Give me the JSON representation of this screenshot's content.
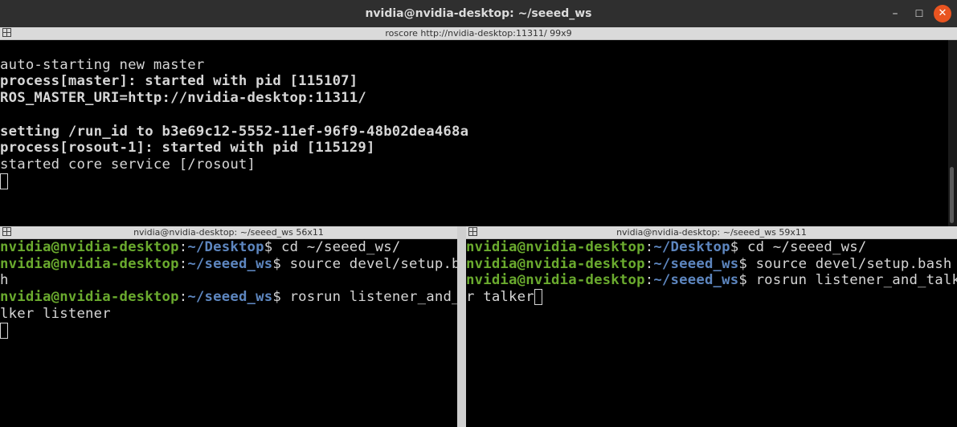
{
  "window": {
    "title": "nvidia@nvidia-desktop: ~/seeed_ws",
    "minimize_icon": "minimize-icon",
    "maximize_icon": "maximize-icon",
    "close_icon": "close-icon",
    "minimize_glyph": "–",
    "maximize_glyph": "☐",
    "close_glyph": "✕"
  },
  "top_pane": {
    "title": "roscore http://nvidia-desktop:11311/ 99x9",
    "lines": [
      {
        "text": "",
        "bold": false
      },
      {
        "text": "auto-starting new master",
        "bold": false
      },
      {
        "text": "process[master]: started with pid [115107]",
        "bold": true
      },
      {
        "text": "ROS_MASTER_URI=http://nvidia-desktop:11311/",
        "bold": true
      },
      {
        "text": "",
        "bold": false
      },
      {
        "text": "setting /run_id to b3e69c12-5552-11ef-96f9-48b02dea468a",
        "bold": true
      },
      {
        "text": "process[rosout-1]: started with pid [115129]",
        "bold": true
      },
      {
        "text": "started core service [/rosout]",
        "bold": false
      }
    ]
  },
  "left_pane": {
    "title": "nvidia@nvidia-desktop: ~/seeed_ws 56x11",
    "lines": [
      [
        {
          "t": "nvidia@nvidia-desktop",
          "c": "g"
        },
        {
          "t": ":",
          "c": "w"
        },
        {
          "t": "~/Desktop",
          "c": "b"
        },
        {
          "t": "$ cd ~/seeed_ws/",
          "c": "w"
        }
      ],
      [
        {
          "t": "nvidia@nvidia-desktop",
          "c": "g"
        },
        {
          "t": ":",
          "c": "w"
        },
        {
          "t": "~/seeed_ws",
          "c": "b"
        },
        {
          "t": "$ source devel/setup.bas",
          "c": "w"
        }
      ],
      [
        {
          "t": "h",
          "c": "w"
        }
      ],
      [
        {
          "t": "nvidia@nvidia-desktop",
          "c": "g"
        },
        {
          "t": ":",
          "c": "w"
        },
        {
          "t": "~/seeed_ws",
          "c": "b"
        },
        {
          "t": "$ rosrun listener_and_ta",
          "c": "w"
        }
      ],
      [
        {
          "t": "lker listener",
          "c": "w"
        }
      ]
    ]
  },
  "right_pane": {
    "title": "nvidia@nvidia-desktop: ~/seeed_ws 59x11",
    "lines": [
      [
        {
          "t": "nvidia@nvidia-desktop",
          "c": "g"
        },
        {
          "t": ":",
          "c": "w"
        },
        {
          "t": "~/Desktop",
          "c": "b"
        },
        {
          "t": "$ cd ~/seeed_ws/",
          "c": "w"
        }
      ],
      [
        {
          "t": "nvidia@nvidia-desktop",
          "c": "g"
        },
        {
          "t": ":",
          "c": "w"
        },
        {
          "t": "~/seeed_ws",
          "c": "b"
        },
        {
          "t": "$ source devel/setup.bash",
          "c": "w"
        }
      ],
      [
        {
          "t": "nvidia@nvidia-desktop",
          "c": "g"
        },
        {
          "t": ":",
          "c": "w"
        },
        {
          "t": "~/seeed_ws",
          "c": "b"
        },
        {
          "t": "$ rosrun listener_and_talke",
          "c": "w"
        }
      ],
      [
        {
          "t": "r talker",
          "c": "w"
        }
      ]
    ]
  },
  "icons": {
    "split": "split-pane-icon",
    "cursor": "terminal-cursor"
  },
  "colors": {
    "prompt_user": "#6aaa2e",
    "prompt_path": "#5d86bf",
    "text": "#d6d6d6",
    "close_button": "#e95420"
  }
}
